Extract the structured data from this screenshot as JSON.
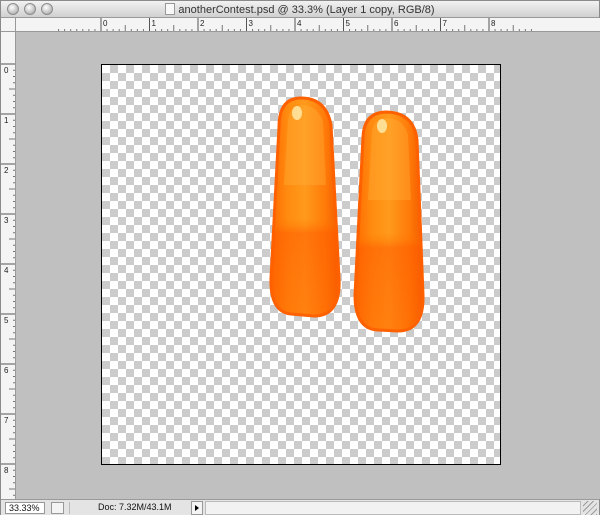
{
  "window": {
    "title": "anotherContest.psd @ 33.3% (Layer 1 copy, RGB/8)"
  },
  "rulers": {
    "horizontal_labels": [
      "0",
      "1",
      "2",
      "3",
      "4",
      "5",
      "6",
      "7",
      "8"
    ],
    "vertical_labels": [
      "0",
      "1",
      "2",
      "3",
      "4",
      "5",
      "6",
      "7",
      "8"
    ]
  },
  "canvas": {
    "transparency": "checkerboard",
    "layer_content": "two-orange-candy-shapes"
  },
  "statusbar": {
    "zoom": "33.33%",
    "doc_info": "Doc: 7.32M/43.1M"
  },
  "colors": {
    "pasteboard": "#c0c0c0",
    "shape_orange": "#ff7a00",
    "shape_highlight": "#ffb13d"
  }
}
